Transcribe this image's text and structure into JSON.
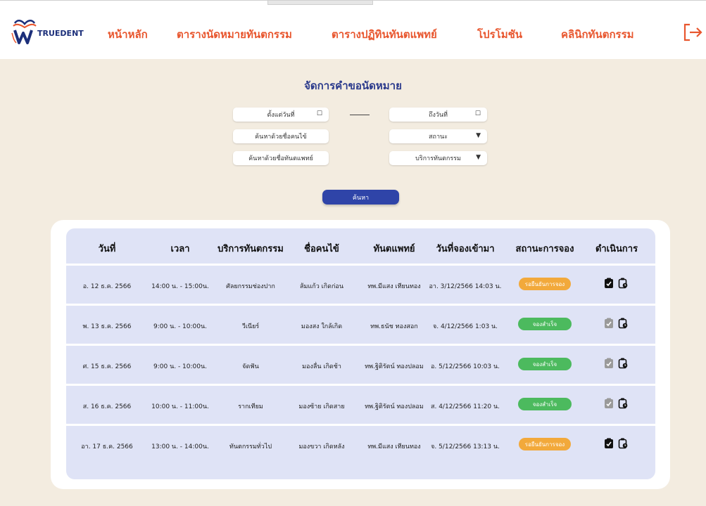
{
  "header": {
    "logo_text": "TRUEDENT",
    "nav": [
      {
        "label": "หน้าหลัก"
      },
      {
        "label": "ตารางนัดหมายทันตกรรม"
      },
      {
        "label": "ตารางปฏิทินทันตแพทย์"
      },
      {
        "label": "โปรโมชัน"
      },
      {
        "label": "คลินิกทันตกรรม"
      }
    ],
    "logout_icon": "logout-icon",
    "brand_color": "#e8562e"
  },
  "page": {
    "title": "จัดการคำขอนัดหมาย"
  },
  "filters": {
    "from_date": "ตั้งแต่วันที่",
    "to_date": "ถึงวันที่",
    "patient_search": "ค้นหาด้วยชื่อคนไข้",
    "status": "สถานะ",
    "dentist_search": "ค้นหาด้วยชื่อทันตแพทย์",
    "service": "บริการทันตกรรม",
    "search_button": "ค้นหา"
  },
  "table": {
    "headers": [
      "วันที่",
      "เวลา",
      "บริการทันตกรรม",
      "ชื่อคนไข้",
      "ทันตแพทย์",
      "วันที่จองเข้ามา",
      "สถานะการจอง",
      "ดำเนินการ"
    ],
    "rows": [
      {
        "date": "อ. 12 ธ.ค. 2566",
        "time": "14:00 น. - 15:00น.",
        "service": "ศัลยกรรมช่องปาก",
        "patient": "ส้มแก้ว เกิดก่อน",
        "dentist": "ทพ.มีแสง เทียนทอง",
        "booked": "อา. 3/12/2566 14:03 น.",
        "status": "รอยืนยันการจอง",
        "status_type": "pending"
      },
      {
        "date": "พ. 13 ธ.ค. 2566",
        "time": "9:00 น. - 10:00น.",
        "service": "วีเนียร์",
        "patient": "มองสง ใกล้เกิด",
        "dentist": "ทพ.ธนัช ทองสอก",
        "booked": "จ. 4/12/2566 1:03 น.",
        "status": "จองสำเร็จ",
        "status_type": "ok"
      },
      {
        "date": "ศ. 15 ธ.ค. 2566",
        "time": "9:00 น. - 10:00น.",
        "service": "จัดฟัน",
        "patient": "มองลื่น เกิดช้า",
        "dentist": "ทพ.ฐิติรัตน์ ทองปลอม",
        "booked": "อ. 5/12/2566 10:03 น.",
        "status": "จองสำเร็จ",
        "status_type": "ok"
      },
      {
        "date": "ส. 16 ธ.ค. 2566",
        "time": "10:00 น. - 11:00น.",
        "service": "รากเทียม",
        "patient": "มองซ้าย เกิดสาย",
        "dentist": "ทพ.ฐิติรัตน์ ทองปลอม",
        "booked": "ส. 4/12/2566 11:20 น.",
        "status": "จองสำเร็จ",
        "status_type": "ok"
      },
      {
        "date": "อา. 17 ธ.ค. 2566",
        "time": "13:00 น. - 14:00น.",
        "service": "ทันตกรรมทั่วไป",
        "patient": "มองขวา เกิดหลัง",
        "dentist": "ทพ.มีแสง เทียนทอง",
        "booked": "จ. 5/12/2566 13:13 น.",
        "status": "รอยืนยันการจอง",
        "status_type": "pending"
      }
    ]
  },
  "colors": {
    "title": "#2b3a8c",
    "search_button": "#2f44a8",
    "pending": "#f2a93b",
    "ok": "#4cba5e",
    "background": "#f3ece0",
    "table": "#dfe3f6"
  }
}
